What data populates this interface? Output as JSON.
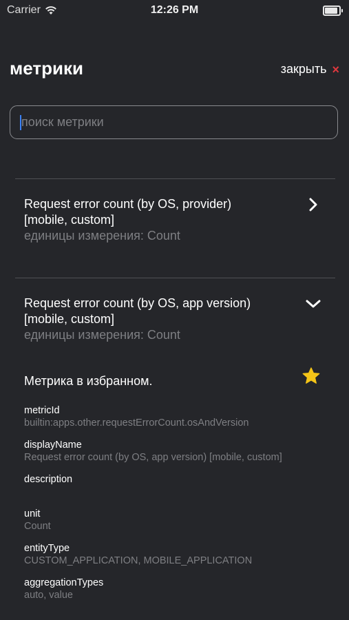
{
  "status_bar": {
    "carrier": "Carrier",
    "time": "12:26 PM"
  },
  "header": {
    "title": "метрики",
    "close_label": "закрыть",
    "close_glyph": "×"
  },
  "search": {
    "placeholder": "поиск метрики",
    "value": ""
  },
  "metrics": [
    {
      "title_line1": "Request error count (by OS, provider)",
      "title_line2": "[mobile, custom]",
      "units": "единицы измерения: Count",
      "expanded": false
    },
    {
      "title_line1": "Request error count (by OS, app version)",
      "title_line2": "[mobile, custom]",
      "units": "единицы измерения: Count",
      "expanded": true
    }
  ],
  "details": {
    "favorite_label": "Метрика в избранном.",
    "favorite_color": "#f5c518",
    "fields": [
      {
        "key": "metricId",
        "value": "builtin:apps.other.requestErrorCount.osAndVersion"
      },
      {
        "key": "displayName",
        "value": "Request error count (by OS, app version) [mobile, custom]"
      },
      {
        "key": "description",
        "value": ""
      },
      {
        "key": "unit",
        "value": "Count"
      },
      {
        "key": "entityType",
        "value": "CUSTOM_APPLICATION, MOBILE_APPLICATION"
      },
      {
        "key": "aggregationTypes",
        "value": "auto, value"
      }
    ]
  },
  "colors": {
    "background": "#25262a",
    "close_accent": "#e0383e",
    "caret": "#3b82f6"
  }
}
